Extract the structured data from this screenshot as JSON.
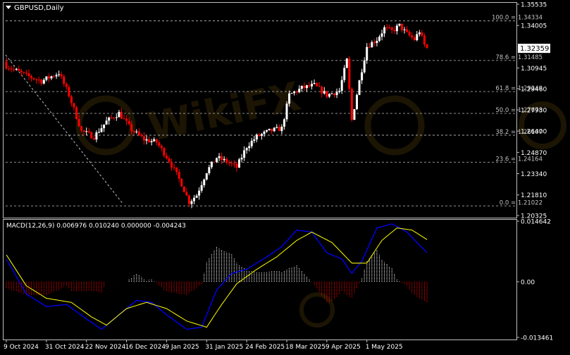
{
  "window": {
    "symbol_label": "GBPUSD,Daily",
    "menu_icon": "triangle-down-icon",
    "watermark": "WikiFX"
  },
  "colors": {
    "background": "#000000",
    "frame": "#c0c0c0",
    "text": "#ffffff",
    "grid": "#ffffff",
    "bull_candle": "#ffffff",
    "bear_candle": "#ff0000",
    "fib_line": "#c0c0c0",
    "macd_line": "#0000ff",
    "signal_line": "#ffff00",
    "hist_positive": "#ffffff",
    "hist_negative": "#ff0000",
    "price_tag_bg": "#ffffff",
    "price_tag_text": "#000000"
  },
  "main_pane": {
    "current_price": "1.32359",
    "price_axis_labels": [
      "1.35535",
      "1.34005",
      "1.30945",
      "1.29460",
      "1.27930",
      "1.26400",
      "1.24870",
      "1.23340",
      "1.21810",
      "1.20325"
    ],
    "fib_levels": [
      {
        "label": "100.0 = 1.34334",
        "value": 1.34334
      },
      {
        "label": "78.6 = 1.31485",
        "value": 1.31485
      },
      {
        "label": "61.8 = 1.29249",
        "value": 1.29249
      },
      {
        "label": "50.0 = 1.27678",
        "value": 1.27678
      },
      {
        "label": "38.2 = 1.26107",
        "value": 1.26107
      },
      {
        "label": "23.6 = 1.24164",
        "value": 1.24164
      },
      {
        "label": "0.0 = 1.21022",
        "value": 1.21022
      }
    ]
  },
  "macd_pane": {
    "label": "MACD(12,26,9) 0.006976 0.010240 0.000000 -0.004243",
    "axis_labels": [
      "0.014642",
      "0.00",
      "-0.013461"
    ]
  },
  "time_axis": {
    "labels": [
      "9 Oct 2024",
      "31 Oct 2024",
      "22 Nov 2024",
      "16 Dec 2024",
      "9 Jan 2025",
      "31 Jan 2025",
      "24 Feb 2025",
      "18 Mar 2025",
      "9 Apr 2025",
      "1 May 2025"
    ]
  },
  "chart_data": {
    "type": "candlestick",
    "symbol": "GBPUSD",
    "timeframe": "Daily",
    "ylim": [
      1.20325,
      1.35535
    ],
    "anchors": [
      {
        "i": 0,
        "price": 1.311
      },
      {
        "i": 8,
        "price": 1.304
      },
      {
        "i": 14,
        "price": 1.3
      },
      {
        "i": 21,
        "price": 1.306
      },
      {
        "i": 25,
        "price": 1.29
      },
      {
        "i": 30,
        "price": 1.264
      },
      {
        "i": 35,
        "price": 1.26
      },
      {
        "i": 40,
        "price": 1.271
      },
      {
        "i": 45,
        "price": 1.277
      },
      {
        "i": 50,
        "price": 1.265
      },
      {
        "i": 55,
        "price": 1.258
      },
      {
        "i": 60,
        "price": 1.256
      },
      {
        "i": 65,
        "price": 1.243
      },
      {
        "i": 70,
        "price": 1.226
      },
      {
        "i": 73,
        "price": 1.213
      },
      {
        "i": 76,
        "price": 1.218
      },
      {
        "i": 80,
        "price": 1.235
      },
      {
        "i": 84,
        "price": 1.245
      },
      {
        "i": 88,
        "price": 1.242
      },
      {
        "i": 92,
        "price": 1.238
      },
      {
        "i": 96,
        "price": 1.253
      },
      {
        "i": 100,
        "price": 1.26
      },
      {
        "i": 105,
        "price": 1.264
      },
      {
        "i": 110,
        "price": 1.266
      },
      {
        "i": 113,
        "price": 1.29
      },
      {
        "i": 118,
        "price": 1.295
      },
      {
        "i": 123,
        "price": 1.297
      },
      {
        "i": 128,
        "price": 1.29
      },
      {
        "i": 133,
        "price": 1.293
      },
      {
        "i": 136,
        "price": 1.315
      },
      {
        "i": 138,
        "price": 1.272
      },
      {
        "i": 141,
        "price": 1.3
      },
      {
        "i": 144,
        "price": 1.325
      },
      {
        "i": 148,
        "price": 1.33
      },
      {
        "i": 151,
        "price": 1.338
      },
      {
        "i": 154,
        "price": 1.336
      },
      {
        "i": 157,
        "price": 1.34
      },
      {
        "i": 160,
        "price": 1.334
      },
      {
        "i": 163,
        "price": 1.33
      },
      {
        "i": 165,
        "price": 1.336
      },
      {
        "i": 167,
        "price": 1.326
      },
      {
        "i": 168,
        "price": 1.32359
      }
    ],
    "bars": 169,
    "macd": {
      "ylim": [
        -0.013461,
        0.014642
      ],
      "macd_anchors": [
        {
          "i": 0,
          "v": 0.0055
        },
        {
          "i": 8,
          "v": -0.003
        },
        {
          "i": 16,
          "v": -0.006
        },
        {
          "i": 24,
          "v": -0.0055
        },
        {
          "i": 32,
          "v": -0.009
        },
        {
          "i": 38,
          "v": -0.0115
        },
        {
          "i": 44,
          "v": -0.0085
        },
        {
          "i": 52,
          "v": -0.0045
        },
        {
          "i": 58,
          "v": -0.005
        },
        {
          "i": 64,
          "v": -0.008
        },
        {
          "i": 72,
          "v": -0.0115
        },
        {
          "i": 78,
          "v": -0.011
        },
        {
          "i": 84,
          "v": -0.002
        },
        {
          "i": 90,
          "v": 0.002
        },
        {
          "i": 96,
          "v": 0.003
        },
        {
          "i": 104,
          "v": 0.006
        },
        {
          "i": 110,
          "v": 0.0085
        },
        {
          "i": 116,
          "v": 0.0125
        },
        {
          "i": 122,
          "v": 0.012
        },
        {
          "i": 128,
          "v": 0.007
        },
        {
          "i": 134,
          "v": 0.0055
        },
        {
          "i": 138,
          "v": 0.002
        },
        {
          "i": 142,
          "v": 0.005
        },
        {
          "i": 148,
          "v": 0.013
        },
        {
          "i": 154,
          "v": 0.014
        },
        {
          "i": 160,
          "v": 0.012
        },
        {
          "i": 168,
          "v": 0.007
        }
      ],
      "signal_anchors": [
        {
          "i": 0,
          "v": 0.0065
        },
        {
          "i": 8,
          "v": -0.001
        },
        {
          "i": 16,
          "v": -0.004
        },
        {
          "i": 26,
          "v": -0.005
        },
        {
          "i": 34,
          "v": -0.0085
        },
        {
          "i": 40,
          "v": -0.0105
        },
        {
          "i": 48,
          "v": -0.0065
        },
        {
          "i": 56,
          "v": -0.005
        },
        {
          "i": 64,
          "v": -0.0065
        },
        {
          "i": 72,
          "v": -0.0095
        },
        {
          "i": 80,
          "v": -0.011
        },
        {
          "i": 86,
          "v": -0.0055
        },
        {
          "i": 92,
          "v": -0.0005
        },
        {
          "i": 100,
          "v": 0.003
        },
        {
          "i": 108,
          "v": 0.006
        },
        {
          "i": 116,
          "v": 0.01
        },
        {
          "i": 122,
          "v": 0.012
        },
        {
          "i": 130,
          "v": 0.0095
        },
        {
          "i": 138,
          "v": 0.0045
        },
        {
          "i": 144,
          "v": 0.0045
        },
        {
          "i": 150,
          "v": 0.01
        },
        {
          "i": 156,
          "v": 0.013
        },
        {
          "i": 162,
          "v": 0.0125
        },
        {
          "i": 168,
          "v": 0.0102
        }
      ]
    }
  }
}
